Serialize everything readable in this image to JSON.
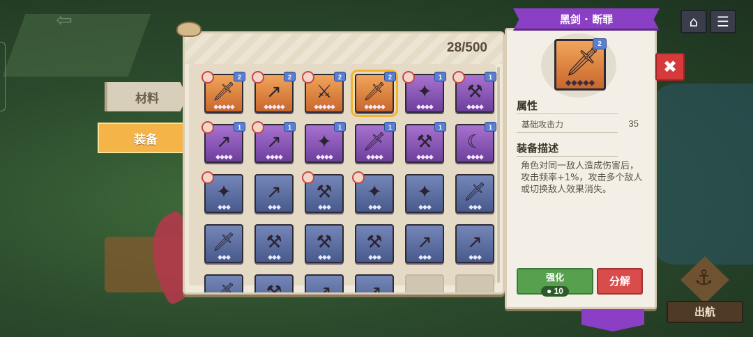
{
  "header": {
    "item_count": "28/500"
  },
  "categories": [
    {
      "label": "材料",
      "active": false
    },
    {
      "label": "装备",
      "active": true
    }
  ],
  "grid": {
    "rows": [
      [
        {
          "rarity": "orange",
          "level": "2",
          "stars": "◆◆◆◆◆",
          "hero": true,
          "weapon": "sword"
        },
        {
          "rarity": "orange",
          "level": "2",
          "stars": "◆◆◆◆◆",
          "hero": true,
          "weapon": "spear"
        },
        {
          "rarity": "orange",
          "level": "2",
          "stars": "◆◆◆◆◆",
          "hero": true,
          "weapon": "greatsword"
        },
        {
          "rarity": "orange",
          "level": "2",
          "stars": "◆◆◆◆◆",
          "hero": false,
          "weapon": "sword",
          "selected": true
        },
        {
          "rarity": "purple",
          "level": "1",
          "stars": "◆◆◆◆",
          "hero": true,
          "weapon": "shuriken"
        },
        {
          "rarity": "purple",
          "level": "1",
          "stars": "◆◆◆◆",
          "hero": true,
          "weapon": "axe"
        }
      ],
      [
        {
          "rarity": "purple",
          "level": "1",
          "stars": "◆◆◆◆",
          "hero": true,
          "weapon": "spear"
        },
        {
          "rarity": "purple",
          "level": "1",
          "stars": "◆◆◆◆",
          "hero": true,
          "weapon": "spear"
        },
        {
          "rarity": "purple",
          "level": "1",
          "stars": "◆◆◆◆",
          "hero": false,
          "weapon": "shuriken"
        },
        {
          "rarity": "purple",
          "level": "1",
          "stars": "◆◆◆◆",
          "hero": false,
          "weapon": "sword"
        },
        {
          "rarity": "purple",
          "level": "1",
          "stars": "◆◆◆◆",
          "hero": false,
          "weapon": "axe"
        },
        {
          "rarity": "purple",
          "level": "1",
          "stars": "◆◆◆◆",
          "hero": false,
          "weapon": "scythe"
        }
      ],
      [
        {
          "rarity": "blue",
          "level": "",
          "stars": "◆◆◆",
          "hero": true,
          "weapon": "shuriken"
        },
        {
          "rarity": "blue",
          "level": "",
          "stars": "◆◆◆",
          "hero": false,
          "weapon": "spear"
        },
        {
          "rarity": "blue",
          "level": "",
          "stars": "◆◆◆",
          "hero": true,
          "weapon": "axe"
        },
        {
          "rarity": "blue",
          "level": "",
          "stars": "◆◆◆",
          "hero": true,
          "weapon": "shuriken"
        },
        {
          "rarity": "blue",
          "level": "",
          "stars": "◆◆◆",
          "hero": false,
          "weapon": "shuriken"
        },
        {
          "rarity": "blue",
          "level": "",
          "stars": "◆◆◆",
          "hero": false,
          "weapon": "sword"
        }
      ],
      [
        {
          "rarity": "blue",
          "level": "",
          "stars": "◆◆◆",
          "hero": false,
          "weapon": "sword"
        },
        {
          "rarity": "blue",
          "level": "",
          "stars": "◆◆◆",
          "hero": false,
          "weapon": "hammer"
        },
        {
          "rarity": "blue",
          "level": "",
          "stars": "◆◆◆",
          "hero": false,
          "weapon": "hammer"
        },
        {
          "rarity": "blue",
          "level": "",
          "stars": "◆◆◆",
          "hero": false,
          "weapon": "hammer"
        },
        {
          "rarity": "blue",
          "level": "",
          "stars": "◆◆◆",
          "hero": false,
          "weapon": "spear"
        },
        {
          "rarity": "blue",
          "level": "",
          "stars": "◆◆◆",
          "hero": false,
          "weapon": "spear"
        }
      ],
      [
        {
          "rarity": "blue",
          "level": "",
          "stars": "",
          "hero": false,
          "weapon": "sword"
        },
        {
          "rarity": "blue",
          "level": "",
          "stars": "",
          "hero": false,
          "weapon": "hammer"
        },
        {
          "rarity": "blue",
          "level": "",
          "stars": "",
          "hero": false,
          "weapon": "spear"
        },
        {
          "rarity": "blue",
          "level": "",
          "stars": "",
          "hero": false,
          "weapon": "spear"
        },
        {
          "rarity": "empty",
          "level": "",
          "stars": "",
          "hero": false,
          "weapon": ""
        },
        {
          "rarity": "empty",
          "level": "",
          "stars": "",
          "hero": false,
          "weapon": ""
        }
      ]
    ]
  },
  "detail": {
    "title": "黑剑 · 断罪",
    "level": "2",
    "stars": "◆◆◆◆◆",
    "attributes_heading": "属性",
    "stat_name": "基础攻击力",
    "stat_value": "35",
    "description_heading": "装备描述",
    "description": "角色对同一敌人造成伤害后，攻击频率+1%，攻击多个敌人或切换敌人效果消失。",
    "enhance_label": "强化",
    "enhance_cost": "10",
    "decompose_label": "分解"
  },
  "nav": {
    "sail_label": "出航"
  },
  "colors": {
    "rarity_orange": "#e08a44",
    "rarity_purple": "#8b55b8",
    "rarity_blue": "#5e6fa3",
    "accent_purple": "#8b3fc4",
    "tab_active": "#f4b447",
    "enhance_green": "#56a04e",
    "decompose_red": "#d94c4c"
  },
  "icons": [
    "back-arrow-icon",
    "home-icon",
    "menu-icon",
    "close-icon",
    "anchor-icon",
    "coin-icon"
  ]
}
